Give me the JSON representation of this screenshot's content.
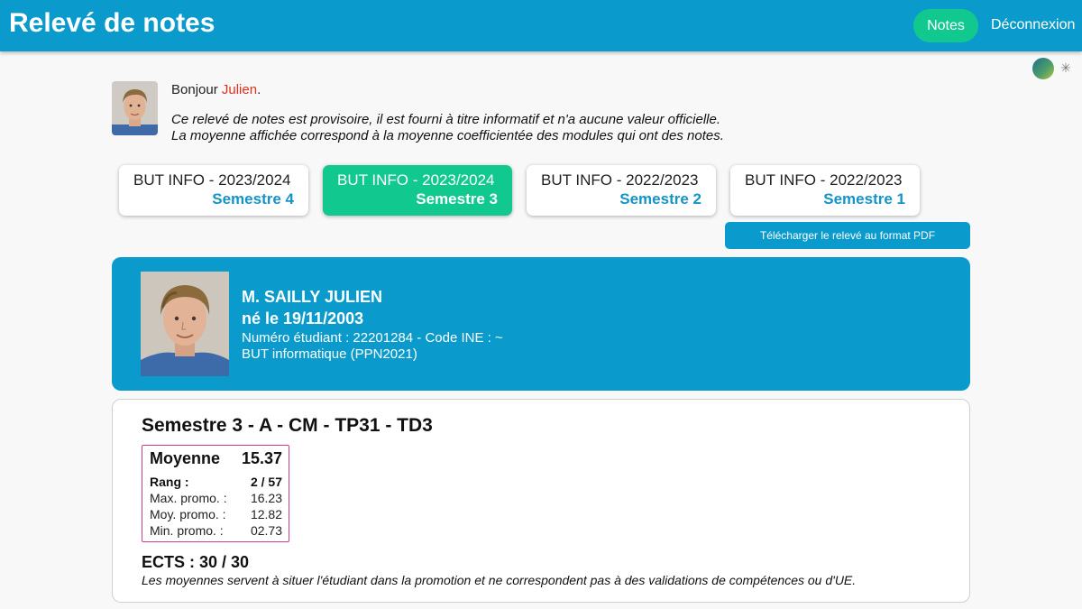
{
  "header": {
    "title": "Relevé de notes",
    "nav_notes": "Notes",
    "nav_logout": "Déconnexion"
  },
  "intro": {
    "greeting_prefix": "Bonjour ",
    "greeting_name": "Julien",
    "greeting_suffix": ".",
    "disclaimer_line1": "Ce relevé de notes est provisoire, il est fourni à titre informatif et n'a aucune valeur officielle.",
    "disclaimer_line2": "La moyenne affichée correspond à la moyenne coefficientée des modules qui ont des notes."
  },
  "semester_tabs": [
    {
      "formation": "BUT INFO - 2023/2024",
      "semester": "Semestre 4",
      "active": false
    },
    {
      "formation": "BUT INFO - 2023/2024",
      "semester": "Semestre 3",
      "active": true
    },
    {
      "formation": "BUT INFO - 2022/2023",
      "semester": "Semestre 2",
      "active": false
    },
    {
      "formation": "BUT INFO - 2022/2023",
      "semester": "Semestre 1",
      "active": false
    }
  ],
  "pdf_button": "Télécharger le relevé au format PDF",
  "student": {
    "name": "M. SAILLY JULIEN",
    "birth": "né le 19/11/2003",
    "numbers": "Numéro étudiant : 22201284 - Code INE : ~",
    "program": "BUT informatique (PPN2021)"
  },
  "semester": {
    "title": "Semestre 3 - A - CM - TP31 - TD3",
    "average_label": "Moyenne",
    "average_value": "15.37",
    "rank_label": "Rang :",
    "rank_value": "2 / 57",
    "max_label": "Max. promo. :",
    "max_value": "16.23",
    "avg_label": "Moy. promo. :",
    "avg_value": "12.82",
    "min_label": "Min. promo. :",
    "min_value": "02.73",
    "ects": "ECTS : 30 / 30",
    "note": "Les moyennes servent à situer l'étudiant dans la promotion et ne correspondent pas à des validations de compétences ou d'UE."
  },
  "colors": {
    "primary": "#0a9bcc",
    "accent": "#11c98e",
    "semester_label": "#1494c8",
    "name_highlight": "#e0301e",
    "average_border": "#d23c8a"
  }
}
